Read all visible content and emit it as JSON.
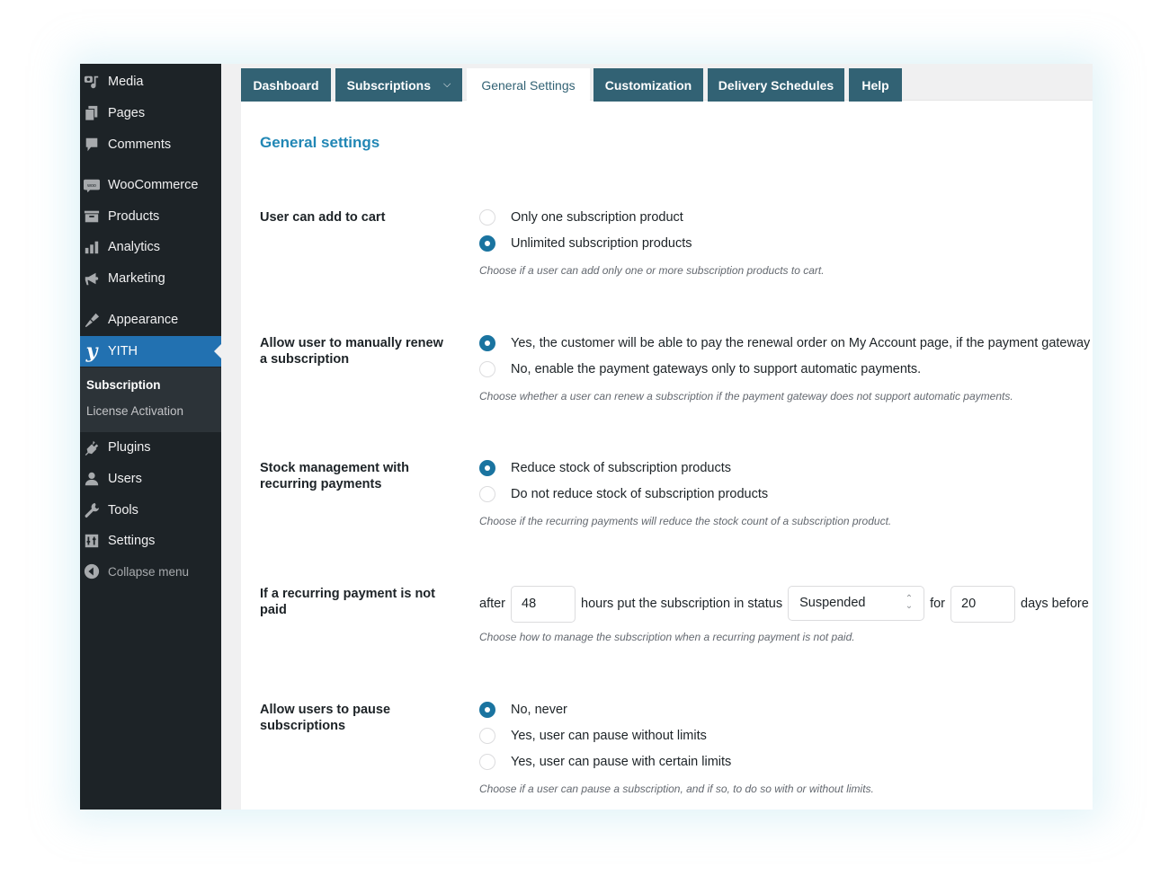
{
  "sidebar": {
    "items": [
      {
        "label": "Media",
        "icon": "media-icon"
      },
      {
        "label": "Pages",
        "icon": "pages-icon"
      },
      {
        "label": "Comments",
        "icon": "comments-icon"
      },
      {
        "label": "WooCommerce",
        "icon": "woocommerce-icon"
      },
      {
        "label": "Products",
        "icon": "products-icon"
      },
      {
        "label": "Analytics",
        "icon": "analytics-icon"
      },
      {
        "label": "Marketing",
        "icon": "marketing-icon"
      },
      {
        "label": "Appearance",
        "icon": "appearance-icon"
      },
      {
        "label": "YITH",
        "icon": "yith-icon",
        "glyph": "y"
      },
      {
        "label": "Plugins",
        "icon": "plugins-icon"
      },
      {
        "label": "Users",
        "icon": "users-icon"
      },
      {
        "label": "Tools",
        "icon": "tools-icon"
      },
      {
        "label": "Settings",
        "icon": "settings-icon"
      },
      {
        "label": "Collapse menu",
        "icon": "collapse-icon"
      }
    ],
    "submenu": [
      {
        "label": "Subscription",
        "current": true
      },
      {
        "label": "License Activation",
        "current": false
      }
    ]
  },
  "tabs": [
    {
      "label": "Dashboard",
      "active": false
    },
    {
      "label": "Subscriptions",
      "active": false,
      "dropdown": "⌄"
    },
    {
      "label": "General Settings",
      "active": true
    },
    {
      "label": "Customization",
      "active": false
    },
    {
      "label": "Delivery Schedules",
      "active": false
    },
    {
      "label": "Help",
      "active": false
    }
  ],
  "section_title": "General settings",
  "fields": {
    "add_to_cart": {
      "label": "User can add to cart",
      "options": [
        "Only one subscription product",
        "Unlimited subscription products"
      ],
      "selected": 1,
      "description": "Choose if a user can add only one or more subscription products to cart."
    },
    "manual_renew": {
      "label": "Allow user to manually renew a subscription",
      "options": [
        "Yes, the customer will be able to pay the renewal order on My Account page, if the payment gateway",
        "No, enable the payment gateways only to support automatic payments."
      ],
      "selected": 0,
      "description": "Choose whether a user can renew a subscription if the payment gateway does not support automatic payments."
    },
    "stock": {
      "label": "Stock management with recurring payments",
      "options": [
        "Reduce stock of subscription products",
        "Do not reduce stock of subscription products"
      ],
      "selected": 0,
      "description": "Choose if the recurring payments will reduce the stock count of a subscription product."
    },
    "not_paid": {
      "label": "If a recurring payment is not paid",
      "text_after": "after",
      "hours_value": "48",
      "text_hours": "hours put the subscription in status",
      "status_value": "Suspended",
      "text_for": "for",
      "days_value": "20",
      "text_days": "days before",
      "description": "Choose how to manage the subscription when a recurring payment is not paid."
    },
    "pause": {
      "label": "Allow users to pause subscriptions",
      "options": [
        "No, never",
        "Yes, user can pause without limits",
        "Yes, user can pause with certain limits"
      ],
      "selected": 0,
      "description": "Choose if a user can pause a subscription, and if so, to do so with or without limits."
    }
  },
  "colors": {
    "sidebar_bg": "#1d2327",
    "active_menu": "#2271b1",
    "tab_bg": "#326274",
    "accent": "#2187b5",
    "radio_checked": "#1a74a0"
  }
}
